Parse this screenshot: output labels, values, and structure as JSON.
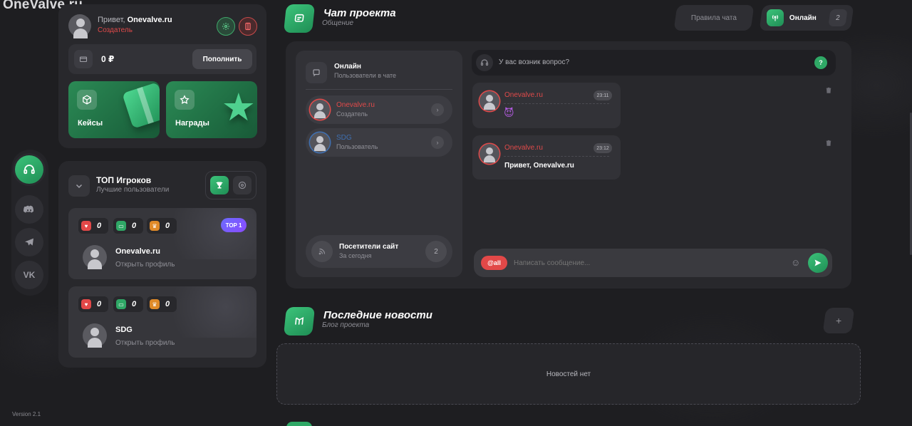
{
  "app": {
    "logo": "OneValve.ru",
    "version": "Version 2.1"
  },
  "rail": {
    "items": [
      "support-icon",
      "discord-icon",
      "telegram-icon",
      "vk-icon"
    ],
    "active": 0
  },
  "profile": {
    "greeting": "Привет,",
    "username": "Onevalve.ru",
    "role": "Создатель",
    "balance": "0 ₽",
    "topup_label": "Пополнить",
    "tiles": [
      {
        "label": "Кейсы",
        "icon": "cube-icon"
      },
      {
        "label": "Награды",
        "icon": "star-icon"
      }
    ]
  },
  "top_players": {
    "title": "ТОП Игроков",
    "subtitle": "Лучшие пользователи",
    "badge": "TOP 1",
    "players": [
      {
        "name": "Onevalve.ru",
        "link": "Открыть профиль",
        "stats": [
          "0",
          "0",
          "0"
        ]
      },
      {
        "name": "SDG",
        "link": "Открыть профиль",
        "stats": [
          "0",
          "0",
          "0"
        ]
      }
    ]
  },
  "chat": {
    "title": "Чат проекта",
    "subtitle": "Общение",
    "rules_label": "Правила чата",
    "online_label": "Онлайн",
    "online_count": "2",
    "users_panel": {
      "title": "Онлайн",
      "subtitle": "Пользователи в чате",
      "users": [
        {
          "name": "Onevalve.ru",
          "role": "Создатель",
          "color": "#e04a4a"
        },
        {
          "name": "SDG",
          "role": "Пользователь",
          "color": "#3f6fb0"
        }
      ],
      "visitors_title": "Посетители сайт",
      "visitors_sub": "За сегодня",
      "visitors_count": "2"
    },
    "question_text": "У вас возник вопрос?",
    "help_mark": "?",
    "messages": [
      {
        "author": "Onevalve.ru",
        "time": "23:11",
        "text": "😈"
      },
      {
        "author": "Onevalve.ru",
        "time": "23:12",
        "text": "Привет, Onevalve.ru"
      }
    ],
    "mention_label": "@all",
    "input_placeholder": "Написать сообщение..."
  },
  "news": {
    "title": "Последние новости",
    "subtitle": "Блог проекта",
    "add_label": "+",
    "empty_text": "Новостей нет"
  },
  "colors": {
    "accent": "#2fa866",
    "danger": "#e24848",
    "bg": "#1e1e21"
  }
}
